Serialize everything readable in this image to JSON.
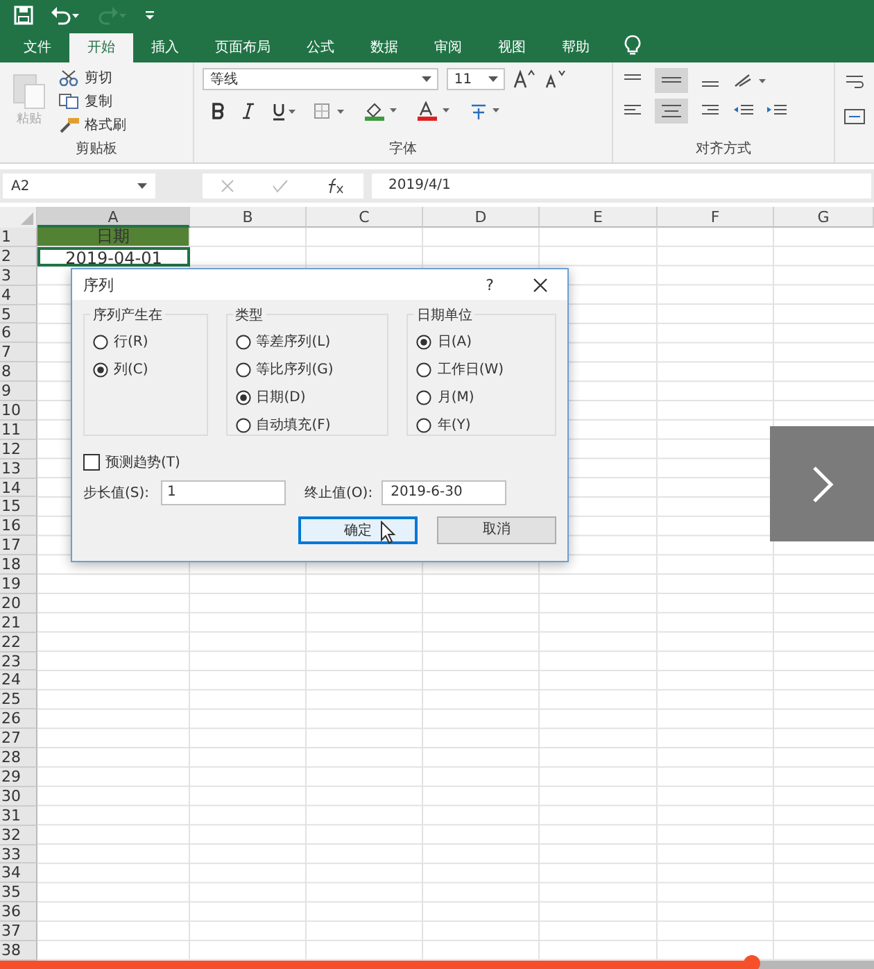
{
  "quick_access": [
    {
      "kind": "save",
      "disabled": false
    },
    {
      "kind": "undo",
      "disabled": false
    },
    {
      "kind": "redo",
      "disabled": true
    },
    {
      "kind": "customize",
      "disabled": false
    }
  ],
  "tabs": [
    {
      "label": "文件",
      "selected": false
    },
    {
      "label": "开始",
      "selected": true
    },
    {
      "label": "插入",
      "selected": false
    },
    {
      "label": "页面布局",
      "selected": false
    },
    {
      "label": "公式",
      "selected": false
    },
    {
      "label": "数据",
      "selected": false
    },
    {
      "label": "审阅",
      "selected": false
    },
    {
      "label": "视图",
      "selected": false
    },
    {
      "label": "帮助",
      "selected": false
    }
  ],
  "ribbon": {
    "clipboard": {
      "paste": {
        "label": "粘贴",
        "disabled": true
      },
      "items": [
        {
          "kind": "cut",
          "label": "剪切"
        },
        {
          "kind": "copy",
          "label": "复制"
        },
        {
          "kind": "painter",
          "label": "格式刷"
        }
      ],
      "label": "剪贴板"
    },
    "font": {
      "font_name": "等线",
      "font_size": "11",
      "label": "字体"
    },
    "alignment": {
      "label": "对齐方式"
    }
  },
  "name_box": "A2",
  "formula": "2019/4/1",
  "sheet": {
    "columns": [
      {
        "label": "A",
        "selected": true
      },
      {
        "label": "B",
        "selected": false
      },
      {
        "label": "C",
        "selected": false
      },
      {
        "label": "D",
        "selected": false
      },
      {
        "label": "E",
        "selected": false
      },
      {
        "label": "F",
        "selected": false
      },
      {
        "label": "G",
        "selected": false
      }
    ],
    "rows": [
      {
        "number": "1",
        "cells": [
          {
            "text": "日期",
            "kind": "header",
            "selected": false
          }
        ]
      },
      {
        "number": "2",
        "cells": [
          {
            "text": "2019-04-01",
            "kind": "date",
            "selected": true
          }
        ]
      },
      {
        "number": "3"
      },
      {
        "number": "4"
      },
      {
        "number": "5"
      },
      {
        "number": "6"
      },
      {
        "number": "7"
      },
      {
        "number": "8"
      },
      {
        "number": "9"
      },
      {
        "number": "10"
      },
      {
        "number": "11"
      },
      {
        "number": "12"
      },
      {
        "number": "13"
      },
      {
        "number": "14"
      },
      {
        "number": "15"
      },
      {
        "number": "16"
      },
      {
        "number": "17"
      },
      {
        "number": "18"
      },
      {
        "number": "19"
      },
      {
        "number": "20"
      },
      {
        "number": "21"
      },
      {
        "number": "22"
      },
      {
        "number": "23"
      },
      {
        "number": "24"
      },
      {
        "number": "25"
      },
      {
        "number": "26"
      },
      {
        "number": "27"
      },
      {
        "number": "28"
      },
      {
        "number": "29"
      },
      {
        "number": "30"
      },
      {
        "number": "31"
      },
      {
        "number": "32"
      },
      {
        "number": "33"
      },
      {
        "number": "34"
      },
      {
        "number": "35"
      },
      {
        "number": "36"
      },
      {
        "number": "37"
      },
      {
        "number": "38"
      }
    ]
  },
  "dialog": {
    "title": "序列",
    "help": "?",
    "groups": [
      {
        "title": "序列产生在",
        "options": [
          {
            "label": "行(R)",
            "selected": false
          },
          {
            "label": "列(C)",
            "selected": true
          }
        ]
      },
      {
        "title": "类型",
        "options": [
          {
            "label": "等差序列(L)",
            "selected": false
          },
          {
            "label": "等比序列(G)",
            "selected": false
          },
          {
            "label": "日期(D)",
            "selected": true
          },
          {
            "label": "自动填充(F)",
            "selected": false
          }
        ]
      },
      {
        "title": "日期单位",
        "options": [
          {
            "label": "日(A)",
            "selected": true
          },
          {
            "label": "工作日(W)",
            "selected": false
          },
          {
            "label": "月(M)",
            "selected": false
          },
          {
            "label": "年(Y)",
            "selected": false
          }
        ]
      }
    ],
    "trend": {
      "label": "预测趋势(T)",
      "checked": false
    },
    "step": {
      "label": "步长值(S):",
      "value": "1"
    },
    "stop": {
      "label": "终止值(O):",
      "value": "2019-6-30"
    },
    "buttons": [
      {
        "label": "确定",
        "default": true
      },
      {
        "label": "取消",
        "default": false
      }
    ]
  },
  "player": {
    "level": 0.86
  }
}
